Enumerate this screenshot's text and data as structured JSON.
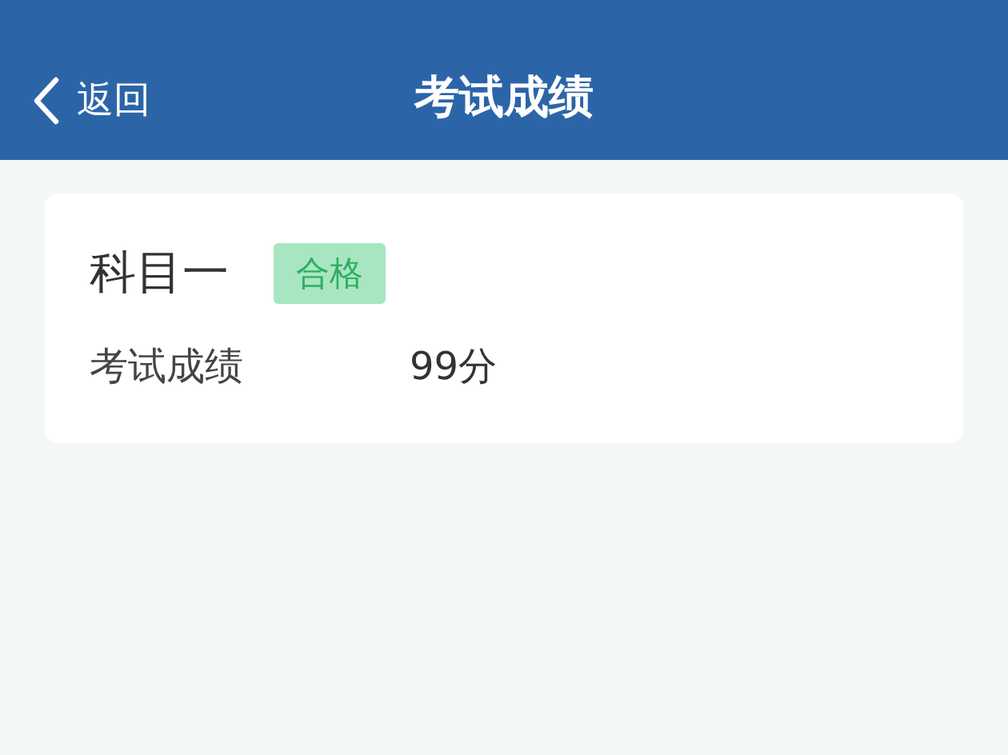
{
  "nav": {
    "back": "返回",
    "title": "考试成绩"
  },
  "card": {
    "subject": "科目一",
    "tag": {
      "label": "合格",
      "color": "#a8e6c1"
    },
    "rows": [
      {
        "label": "考试成绩",
        "value": "99分"
      }
    ]
  }
}
